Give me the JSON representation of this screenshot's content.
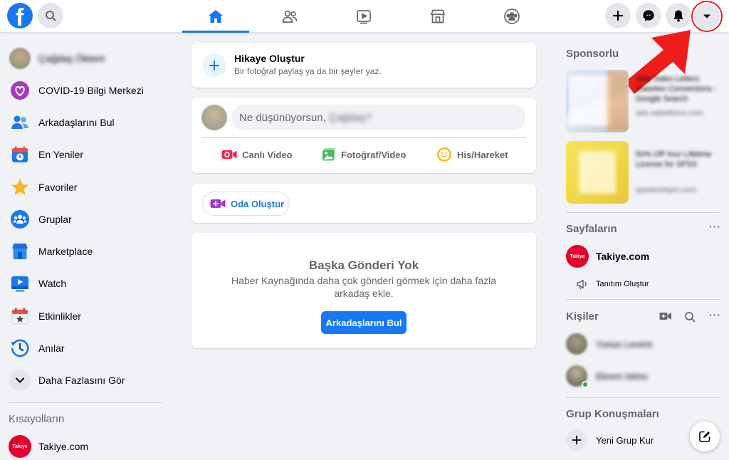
{
  "header": {
    "logo_letter": "f",
    "tabs": [
      "home",
      "friends",
      "watch",
      "marketplace",
      "groups"
    ]
  },
  "left_sidebar": {
    "user_name": "Çağdaş Öktem",
    "items": [
      {
        "label": "COVID-19 Bilgi Merkezi",
        "icon": "covid-heart-icon"
      },
      {
        "label": "Arkadaşlarını Bul",
        "icon": "friends-icon"
      },
      {
        "label": "En Yeniler",
        "icon": "most-recent-icon"
      },
      {
        "label": "Favoriler",
        "icon": "star-icon"
      },
      {
        "label": "Gruplar",
        "icon": "groups-icon"
      },
      {
        "label": "Marketplace",
        "icon": "marketplace-icon"
      },
      {
        "label": "Watch",
        "icon": "watch-icon"
      },
      {
        "label": "Etkinlikler",
        "icon": "events-icon"
      },
      {
        "label": "Anılar",
        "icon": "memories-icon"
      }
    ],
    "see_more": "Daha Fazlasını Gör",
    "shortcuts_title": "Kısayolların",
    "shortcuts": [
      {
        "label": "Takiye.com",
        "logo": "Takiye"
      }
    ]
  },
  "feed": {
    "story": {
      "title": "Hikaye Oluştur",
      "subtitle": "Bir fotoğraf paylaş ya da bir şeyler yaz."
    },
    "composer": {
      "placeholder": "Ne düşünüyorsun,",
      "placeholder_name": "Çağdaş?",
      "actions": [
        "Canlı Video",
        "Fotoğraf/Video",
        "His/Hareket"
      ]
    },
    "room_button": "Oda Oluştur",
    "empty": {
      "title": "Başka Gönderi Yok",
      "text": "Haber Kaynağında daha çok gönderi görmek için daha fazla arkadaş ekle.",
      "button": "Arkadaşlarını Bul"
    }
  },
  "right_sidebar": {
    "sponsored_title": "Sponsorlu",
    "ads": [
      {
        "text": "Vote Sales Letters Sweeten Conversions - Google Search",
        "domain": "ads.salesforce.com"
      },
      {
        "text": "50% Off Your Lifetime License for SPSS",
        "domain": "spsstoolspro.com"
      }
    ],
    "pages_title": "Sayfaların",
    "page_name": "Takiye.com",
    "promote": "Tanıtım Oluştur",
    "contacts_title": "Kişiler",
    "contacts": [
      "Yunus Levent",
      "Ekrem Istmo"
    ],
    "group_chats_title": "Grup Konuşmaları",
    "new_group": "Yeni Grup Kur"
  },
  "colors": {
    "brand": "#1877f2",
    "highlight": "#e41e26"
  }
}
